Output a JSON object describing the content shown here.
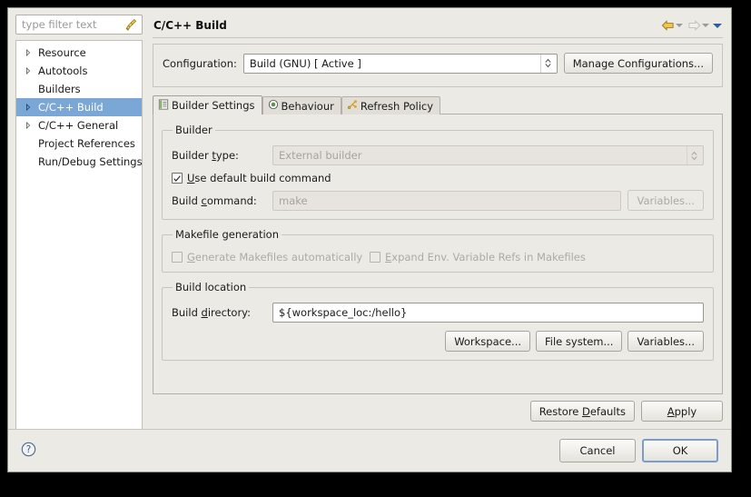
{
  "dialog": {
    "title": "C/C++ Build"
  },
  "sidebar": {
    "filter": {
      "value": "",
      "placeholder": "type filter text",
      "icon": "broom-icon"
    },
    "items": [
      {
        "label": "Resource",
        "expandable": true,
        "selected": false
      },
      {
        "label": "Autotools",
        "expandable": true,
        "selected": false
      },
      {
        "label": "Builders",
        "expandable": false,
        "selected": false
      },
      {
        "label": "C/C++ Build",
        "expandable": true,
        "selected": true
      },
      {
        "label": "C/C++ General",
        "expandable": true,
        "selected": false
      },
      {
        "label": "Project References",
        "expandable": false,
        "selected": false
      },
      {
        "label": "Run/Debug Settings",
        "expandable": false,
        "selected": false
      }
    ]
  },
  "header": {
    "title": "C/C++ Build",
    "nav": {
      "back_icon": "back-arrow-icon",
      "back_dropdown_icon": "chevron-down-icon",
      "forward_icon": "forward-arrow-icon",
      "forward_dropdown_icon": "chevron-down-icon",
      "menu_icon": "view-menu-triangle-icon"
    }
  },
  "configuration": {
    "label": "Configuration:",
    "value": "Build (GNU)  [ Active ]",
    "spinner_icon": "up-down-chevron-icon",
    "manage_button": "Manage Configurations..."
  },
  "tabs": [
    {
      "label": "Builder Settings",
      "icon": "builder-settings-icon",
      "active": true
    },
    {
      "label": "Behaviour",
      "icon": "behaviour-icon",
      "active": false
    },
    {
      "label": "Refresh Policy",
      "icon": "refresh-policy-icon",
      "active": false
    }
  ],
  "builder_group": {
    "legend": "Builder",
    "builder_type": {
      "label_prefix": "Builder ",
      "label_accel": "t",
      "label_suffix": "ype:",
      "value": "External builder",
      "disabled": true,
      "spinner_icon": "up-down-chevron-icon"
    },
    "use_default": {
      "label_prefix": "",
      "label_accel": "U",
      "label_suffix": "se default build command",
      "checked": true,
      "check_icon": "checkmark-icon"
    },
    "build_command": {
      "label_prefix": "Build ",
      "label_accel": "c",
      "label_suffix": "ommand:",
      "value": "make",
      "disabled": true,
      "variables_button": "Variables..."
    }
  },
  "makefile_group": {
    "legend": "Makefile generation",
    "generate": {
      "label_prefix": "",
      "label_accel": "G",
      "label_suffix": "enerate Makefiles automatically",
      "checked": false,
      "disabled": true
    },
    "expand_env": {
      "label_prefix": "",
      "label_accel": "E",
      "label_suffix": "xpand Env. Variable Refs in Makefiles",
      "checked": false,
      "disabled": true
    }
  },
  "build_location_group": {
    "legend": "Build location",
    "build_directory": {
      "label_prefix": "Build ",
      "label_accel": "d",
      "label_suffix": "irectory:",
      "value": "${workspace_loc:/hello}"
    },
    "buttons": [
      "Workspace...",
      "File system...",
      "Variables..."
    ]
  },
  "page_buttons": {
    "restore_prefix": "Restore ",
    "restore_accel": "D",
    "restore_suffix": "efaults",
    "apply_accel": "A",
    "apply_suffix": "pply"
  },
  "footer": {
    "help_icon": "help-question-icon",
    "cancel": "Cancel",
    "ok": "OK"
  },
  "colors": {
    "selection": "#7ba7d7",
    "dialog_bg": "#eceae5",
    "back_arrow": "#d9a520",
    "forward_arrow": "#c9c5be",
    "menu_triangle": "#2c5d9e",
    "focus_border": "#7a9ec9"
  }
}
